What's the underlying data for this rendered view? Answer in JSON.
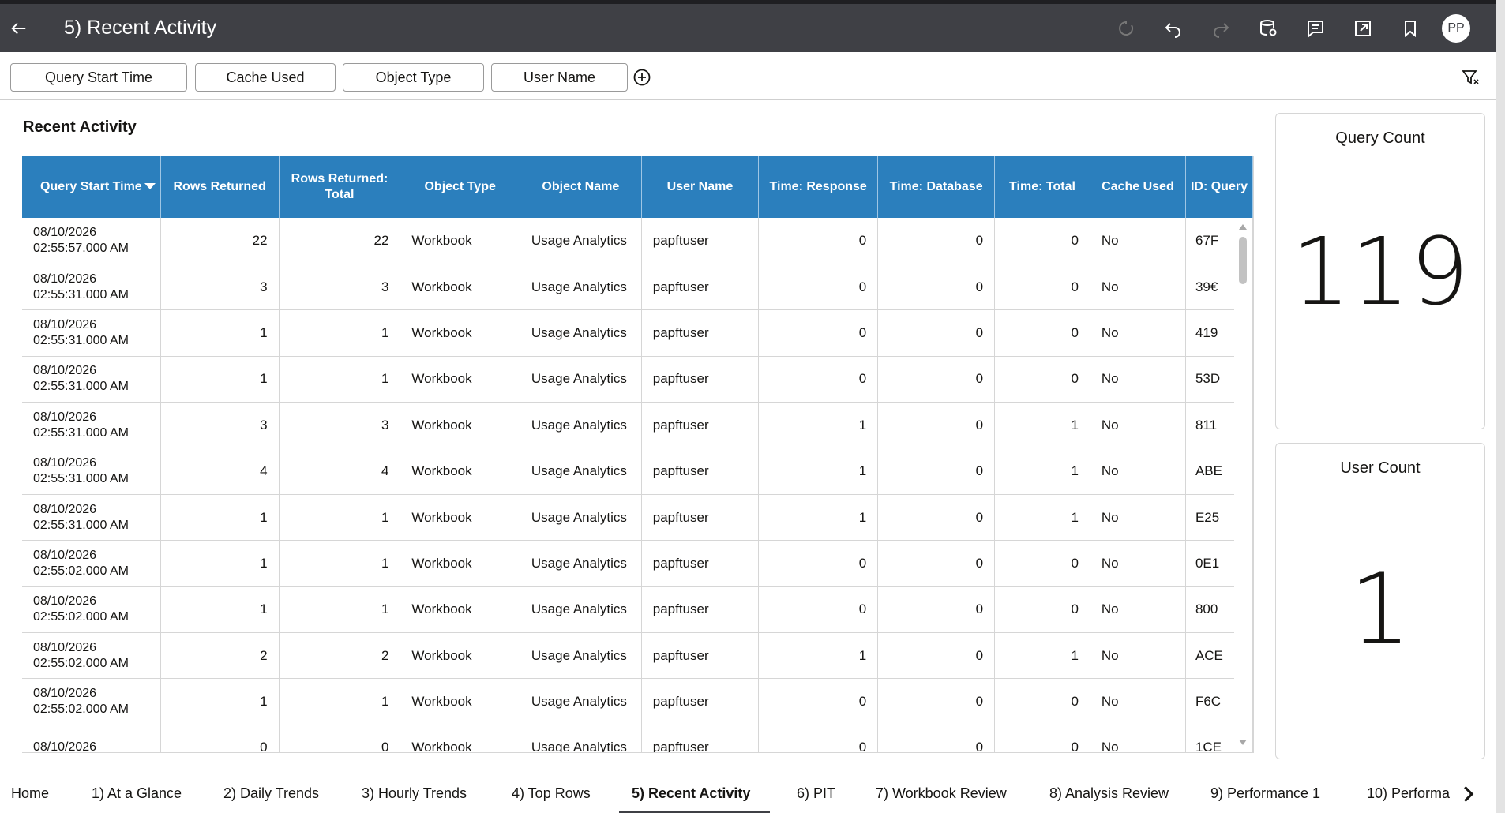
{
  "header": {
    "title": "5) Recent Activity",
    "avatar_initials": "PP",
    "icons": [
      "back-arrow-icon",
      "refresh-icon",
      "undo-icon",
      "redo-icon",
      "data-icon",
      "comment-icon",
      "export-icon",
      "bookmark-icon"
    ]
  },
  "filters": {
    "chips": [
      "Query Start Time",
      "Cache Used",
      "Object Type",
      "User Name"
    ]
  },
  "table": {
    "title": "Recent Activity",
    "columns": [
      "Query Start Time",
      "Rows Returned",
      "Rows Returned: Total",
      "Object Type",
      "Object Name",
      "User Name",
      "Time: Response",
      "Time: Database",
      "Time: Total",
      "Cache Used",
      "ID: Query"
    ],
    "rows": [
      [
        "08/10/2026",
        "02:55:57.000 AM",
        "22",
        "22",
        "Workbook",
        "Usage Analytics",
        "papftuser",
        "0",
        "0",
        "0",
        "No",
        "67F"
      ],
      [
        "08/10/2026",
        "02:55:31.000 AM",
        "3",
        "3",
        "Workbook",
        "Usage Analytics",
        "papftuser",
        "0",
        "0",
        "0",
        "No",
        "39€"
      ],
      [
        "08/10/2026",
        "02:55:31.000 AM",
        "1",
        "1",
        "Workbook",
        "Usage Analytics",
        "papftuser",
        "0",
        "0",
        "0",
        "No",
        "419"
      ],
      [
        "08/10/2026",
        "02:55:31.000 AM",
        "1",
        "1",
        "Workbook",
        "Usage Analytics",
        "papftuser",
        "0",
        "0",
        "0",
        "No",
        "53D"
      ],
      [
        "08/10/2026",
        "02:55:31.000 AM",
        "3",
        "3",
        "Workbook",
        "Usage Analytics",
        "papftuser",
        "1",
        "0",
        "1",
        "No",
        "811"
      ],
      [
        "08/10/2026",
        "02:55:31.000 AM",
        "4",
        "4",
        "Workbook",
        "Usage Analytics",
        "papftuser",
        "1",
        "0",
        "1",
        "No",
        "ABE"
      ],
      [
        "08/10/2026",
        "02:55:31.000 AM",
        "1",
        "1",
        "Workbook",
        "Usage Analytics",
        "papftuser",
        "1",
        "0",
        "1",
        "No",
        "E25"
      ],
      [
        "08/10/2026",
        "02:55:02.000 AM",
        "1",
        "1",
        "Workbook",
        "Usage Analytics",
        "papftuser",
        "0",
        "0",
        "0",
        "No",
        "0E1"
      ],
      [
        "08/10/2026",
        "02:55:02.000 AM",
        "1",
        "1",
        "Workbook",
        "Usage Analytics",
        "papftuser",
        "0",
        "0",
        "0",
        "No",
        "800"
      ],
      [
        "08/10/2026",
        "02:55:02.000 AM",
        "2",
        "2",
        "Workbook",
        "Usage Analytics",
        "papftuser",
        "1",
        "0",
        "1",
        "No",
        "ACE"
      ],
      [
        "08/10/2026",
        "02:55:02.000 AM",
        "1",
        "1",
        "Workbook",
        "Usage Analytics",
        "papftuser",
        "0",
        "0",
        "0",
        "No",
        "F6C"
      ],
      [
        "08/10/2026",
        "",
        "0",
        "0",
        "Workbook",
        "Usage Analytics",
        "papftuser",
        "0",
        "0",
        "0",
        "No",
        "1CE"
      ]
    ]
  },
  "kpis": {
    "query_count": {
      "label": "Query Count",
      "value": "119"
    },
    "user_count": {
      "label": "User Count",
      "value": "1"
    }
  },
  "tabs": {
    "items": [
      "Home",
      "1) At a Glance",
      "2) Daily Trends",
      "3) Hourly Trends",
      "4) Top Rows",
      "5) Recent Activity",
      "6) PIT",
      "7) Workbook Review",
      "8) Analysis Review",
      "9) Performance 1",
      "10) Performa"
    ],
    "active": "5) Recent Activity"
  },
  "colors": {
    "header_bg": "#3f4045",
    "table_header_bg": "#2b7fbd"
  }
}
